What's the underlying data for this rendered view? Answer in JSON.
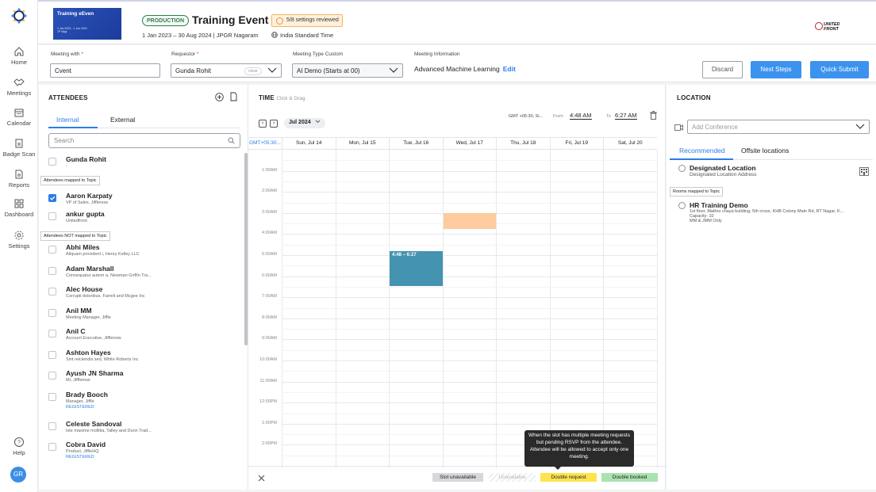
{
  "nav": {
    "items": [
      {
        "label": "Home",
        "icon": "home-icon"
      },
      {
        "label": "Meetings",
        "icon": "handshake-icon"
      },
      {
        "label": "Calendar",
        "icon": "calendar-icon"
      },
      {
        "label": "Badge Scan",
        "icon": "badge-scan-icon"
      },
      {
        "label": "Reports",
        "icon": "reports-icon"
      },
      {
        "label": "Dashboard",
        "icon": "dashboard-icon"
      },
      {
        "label": "Settings",
        "icon": "gear-icon"
      }
    ],
    "help": "Help",
    "avatar": "GR"
  },
  "header": {
    "thumb_title": "Training eEven",
    "thumb_line1": "1 Jan 2023 - 1 Jan 2024",
    "thumb_line2": "JP Nagr",
    "badge": "PRODUCTION",
    "title": "Training Event",
    "review": "5/8 settings reviewed",
    "dates": "1 Jan 2023 – 30 Aug 2024 | JPGR Nagaram",
    "timezone": "India Standard Time",
    "brand_line1": "UNITED",
    "brand_line2": "FRONT"
  },
  "form": {
    "meeting_with_label": "Meeting with",
    "meeting_with_value": "Cvent",
    "requestor_label": "Requestor",
    "requestor_value": "Gunda Rohit",
    "clear": "clear",
    "type_label": "Meeting Type Custom",
    "type_value": "AI Demo (Starts at 00)",
    "info_label": "Meeting Information",
    "info_value": "Advanced Machine Learning",
    "edit": "Edit",
    "required": "*",
    "discard": "Discard",
    "next": "Next Steps",
    "quick": "Quick Submit"
  },
  "attendees": {
    "title": "ATTENDEES",
    "tabs": [
      "Internal",
      "External"
    ],
    "search_placeholder": "Search",
    "mapped_tag": "Attendees mapped to Topic",
    "not_mapped_tag": "Attendees NOT mapped to Topic",
    "list": [
      {
        "name": "Gunda Rohit",
        "sub": "-",
        "checked": false
      },
      {
        "name": "Aaron Karpaty",
        "sub": "VP of Sales, Jifflenow",
        "checked": true
      },
      {
        "name": "ankur gupta",
        "sub": "Unitedfront",
        "checked": false
      },
      {
        "name": "Abhi Miles",
        "sub": "Aliquam provident i, Henry Kelley LLC",
        "checked": false
      },
      {
        "name": "Adam Marshall",
        "sub": "Consequatur autem a, Newman Griffin Tra...",
        "checked": false
      },
      {
        "name": "Alec House",
        "sub": "Corrupti doloribus, Farrell and Mcgee Inc",
        "checked": false
      },
      {
        "name": "Anil MM",
        "sub": "Meeting Manager, Jiffle",
        "checked": false
      },
      {
        "name": "Anil C",
        "sub": "Account Executive, Jifflenow",
        "checked": false
      },
      {
        "name": "Ashton Hayes",
        "sub": "Sint reiciendis sed, White Roberts Inc",
        "checked": false
      },
      {
        "name": "Ayush JN Sharma",
        "sub": "Mr, Jifflenow",
        "checked": false
      },
      {
        "name": "Brady Booch",
        "sub": "Manager, Jiffle",
        "reg": "REGISTERED",
        "checked": false
      },
      {
        "name": "Celeste Sandoval",
        "sub": "Iste maxime mollitia, Talley and Dunn Trad...",
        "checked": false
      },
      {
        "name": "Cobra David",
        "sub": "Product, JiffleHQ",
        "reg": "REGISTERED",
        "checked": false
      }
    ]
  },
  "time": {
    "title": "TIME",
    "hint": "Click & Drag",
    "month": "Jul 2024",
    "tz": "GMT +05:30, Si...",
    "from_label": "From",
    "from_value": "4:48 AM",
    "to_label": "To",
    "to_value": "6:27 AM",
    "tz_col": "GMT+05:30...",
    "days": [
      "Sun, Jul 14",
      "Mon, Jul 15",
      "Tue, Jul 16",
      "Wed, Jul 17",
      "Thu, Jul 18",
      "Fri, Jul 19",
      "Sat, Jul 20"
    ],
    "hours": [
      "1:00AM",
      "2:00AM",
      "3:00AM",
      "4:00AM",
      "5:00AM",
      "6:00AM",
      "7:00AM",
      "8:00AM",
      "9:00AM",
      "10:00AM",
      "11:00AM",
      "12:00PM",
      "1:00PM",
      "2:00PM",
      "3:00PM"
    ],
    "selection_label": "4:48 – 6:27",
    "selection": {
      "day": 2,
      "start": 4.8,
      "end": 6.45
    },
    "blocked": {
      "day": 3,
      "start": 3.0,
      "end": 3.75,
      "color": "#fdcb9e"
    },
    "selection_color": "#4393b1",
    "legend": [
      {
        "label": "Slot unavailable",
        "color": "#d7d8db"
      },
      {
        "label": "Unavailable",
        "color": "#ffffff"
      },
      {
        "label": "Double request",
        "color": "#ffe34d"
      },
      {
        "label": "Double booked",
        "color": "#a9e3b0"
      }
    ],
    "tooltip": "When the slot has multiple meeting requests but pending RSVP from the attendee. Attendee will be allowed to accept only one meeting."
  },
  "location": {
    "title": "LOCATION",
    "conf_placeholder": "Add Conference",
    "tabs": [
      "Recommended",
      "Offsite locations"
    ],
    "rooms_tag": "Rooms mapped to Topic",
    "items": [
      {
        "name": "Designated Location",
        "addr": "Designated Location Address"
      },
      {
        "name": "HR Training Demo",
        "addr": "1st floor, Mathru chaya building, 5th cross, KHB Colony Main Rd, RT Nagar, K...",
        "capacity": "Capacity: 10",
        "note": "MM & JMM Only"
      }
    ]
  }
}
